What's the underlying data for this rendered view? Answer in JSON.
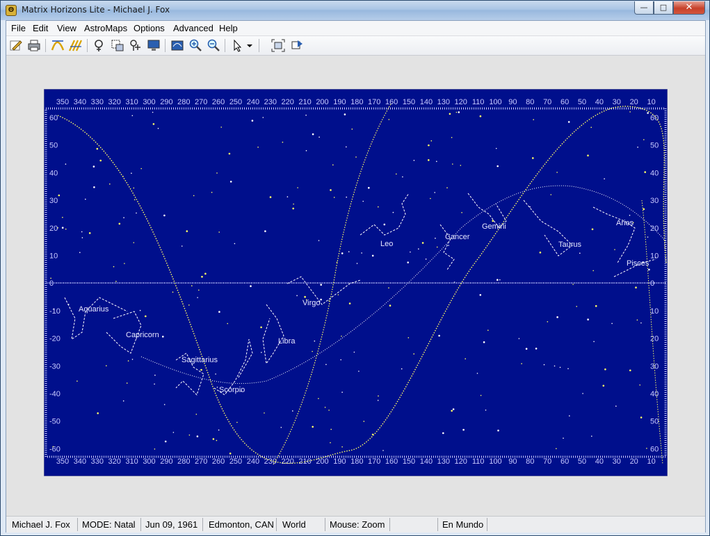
{
  "window": {
    "title": "Matrix Horizons Lite - Michael J. Fox",
    "min": "—",
    "max": "□",
    "close": "✕",
    "app_icon": "app-logo-icon"
  },
  "menu": [
    "File",
    "Edit",
    "View",
    "AstroMaps",
    "Options",
    "Advanced",
    "Help"
  ],
  "toolbar": [
    {
      "name": "edit-chart-icon"
    },
    {
      "name": "print-icon"
    },
    {
      "name": "astro-lines-icon"
    },
    {
      "name": "astro-lines-alt-icon"
    },
    {
      "name": "planet-selector-icon"
    },
    {
      "name": "region-select-icon"
    },
    {
      "name": "planet-add-icon"
    },
    {
      "name": "monitor-icon"
    },
    {
      "name": "full-map-icon"
    },
    {
      "name": "zoom-in-icon"
    },
    {
      "name": "zoom-out-icon"
    },
    {
      "name": "pointer-icon"
    },
    {
      "name": "chevron-down-icon"
    },
    {
      "name": "fit-view-icon"
    },
    {
      "name": "refresh-map-icon"
    }
  ],
  "colors": {
    "map_bg": "#000f8c",
    "grid": "#c8c8ff",
    "constellation": "#ffffff",
    "star": "#ffff66",
    "ecliptic": "#ffffff",
    "labels": "#e6e6ff"
  },
  "map": {
    "top_scale": [
      "350",
      "340",
      "330",
      "320",
      "310",
      "300",
      "290",
      "280",
      "270",
      "260",
      "250",
      "240",
      "230",
      "220",
      "210",
      "200",
      "190",
      "180",
      "170",
      "160",
      "150",
      "140",
      "130",
      "120",
      "110",
      "100",
      "90",
      "80",
      "70",
      "60",
      "50",
      "40",
      "30",
      "20",
      "10"
    ],
    "left_scale": [
      "60",
      "50",
      "40",
      "30",
      "20",
      "10",
      "0",
      "-10",
      "-20",
      "-30",
      "-40",
      "-50",
      "-60"
    ],
    "right_scale": [
      "60",
      "50",
      "40",
      "30",
      "20",
      "10",
      "0",
      "10",
      "20",
      "30",
      "40",
      "50",
      "60"
    ],
    "constellations": [
      "Aquarius",
      "Capricorn",
      "Sagittarius",
      "Scorpio",
      "Libra",
      "Virgo",
      "Leo",
      "Cancer",
      "Gemini",
      "Taurus",
      "Aries",
      "Pisces"
    ]
  },
  "status": [
    "Michael J. Fox",
    "MODE: Natal",
    "Jun 09, 1961",
    "Edmonton, CAN",
    "World",
    "Mouse: Zoom",
    "",
    "En Mundo",
    ""
  ]
}
